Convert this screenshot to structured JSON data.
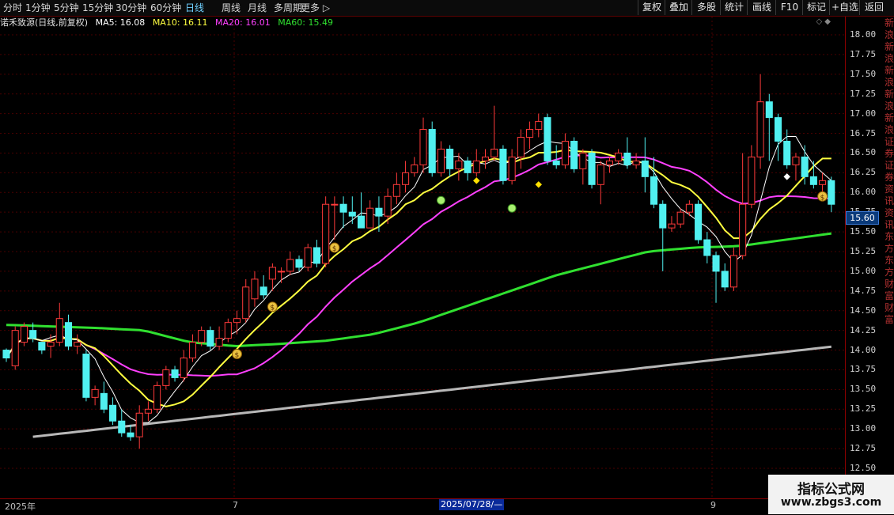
{
  "toolbar": {
    "periods": [
      "分时",
      "1分钟",
      "5分钟",
      "15分钟",
      "30分钟",
      "60分钟",
      "日线",
      "周线",
      "月线",
      "多周期",
      "更多"
    ],
    "active_period": "日线",
    "right_buttons": [
      "复权",
      "叠加",
      "多股",
      "统计",
      "画线",
      "F10",
      "标记",
      "+自选",
      "返回"
    ]
  },
  "title": {
    "name": "诺禾致源(日线,前复权)",
    "ma5": "MA5: 16.08",
    "ma10": "MA10: 16.11",
    "ma20": "MA20: 16.01",
    "ma60": "MA60: 15.49"
  },
  "colors": {
    "ma5": "#ffffff",
    "ma10": "#ffff40",
    "ma20": "#ff40ff",
    "ma60": "#30e030",
    "ma250": "#b8b8b8",
    "up": "#ff3a3a",
    "down": "#50f0f0"
  },
  "current_price": "15.60",
  "x_labels": [
    "2025年",
    "7",
    "9"
  ],
  "x_selected": "2025/07/28/—",
  "right_news": "新浪新浪新浪新浪新浪证券证券资讯资讯东方东方财富财富",
  "chart_data": {
    "type": "candlestick",
    "ylim": [
      12.5,
      18.15
    ],
    "yticks": [
      12.5,
      12.75,
      13.0,
      13.25,
      13.5,
      13.75,
      14.0,
      14.25,
      14.5,
      14.75,
      15.0,
      15.25,
      15.5,
      15.75,
      16.0,
      16.25,
      16.5,
      16.75,
      17.0,
      17.25,
      17.5,
      17.75,
      18.0
    ],
    "candles": [
      [
        14.0,
        13.9,
        13.85,
        14.02
      ],
      [
        13.8,
        14.25,
        13.75,
        14.3
      ],
      [
        14.1,
        14.3,
        14.05,
        14.35
      ],
      [
        14.25,
        14.15,
        14.1,
        14.35
      ],
      [
        14.1,
        14.0,
        13.95,
        14.1
      ],
      [
        14.05,
        14.1,
        13.9,
        14.2
      ],
      [
        14.1,
        14.4,
        14.05,
        14.6
      ],
      [
        14.35,
        14.05,
        14.0,
        14.45
      ],
      [
        14.05,
        14.1,
        13.95,
        14.2
      ],
      [
        13.95,
        13.4,
        13.35,
        14.0
      ],
      [
        13.4,
        13.5,
        13.3,
        13.55
      ],
      [
        13.45,
        13.25,
        13.2,
        13.6
      ],
      [
        13.3,
        13.1,
        13.05,
        13.4
      ],
      [
        13.1,
        12.95,
        12.9,
        13.25
      ],
      [
        12.95,
        12.9,
        12.85,
        13.05
      ],
      [
        12.9,
        13.2,
        12.75,
        13.3
      ],
      [
        13.2,
        13.25,
        13.1,
        13.35
      ],
      [
        13.25,
        13.55,
        13.2,
        13.6
      ],
      [
        13.55,
        13.75,
        13.5,
        13.8
      ],
      [
        13.75,
        13.65,
        13.6,
        13.8
      ],
      [
        13.65,
        13.9,
        13.6,
        14.0
      ],
      [
        13.9,
        14.1,
        13.85,
        14.2
      ],
      [
        14.1,
        14.25,
        14.05,
        14.3
      ],
      [
        14.25,
        14.05,
        14.0,
        14.3
      ],
      [
        14.05,
        14.15,
        14.0,
        14.3
      ],
      [
        14.15,
        14.35,
        14.1,
        14.4
      ],
      [
        14.35,
        14.4,
        14.2,
        14.5
      ],
      [
        14.4,
        14.8,
        14.35,
        14.9
      ],
      [
        14.65,
        14.9,
        14.55,
        15.0
      ],
      [
        14.8,
        14.7,
        14.65,
        14.95
      ],
      [
        14.9,
        15.05,
        14.75,
        15.1
      ],
      [
        15.0,
        15.0,
        14.85,
        15.05
      ],
      [
        15.0,
        15.15,
        14.95,
        15.25
      ],
      [
        15.15,
        15.05,
        15.0,
        15.2
      ],
      [
        15.05,
        15.3,
        15.0,
        15.35
      ],
      [
        15.3,
        15.1,
        15.05,
        15.4
      ],
      [
        15.1,
        15.85,
        15.05,
        15.95
      ],
      [
        15.85,
        15.85,
        15.4,
        15.95
      ],
      [
        15.85,
        15.75,
        15.55,
        15.95
      ],
      [
        15.75,
        15.7,
        15.6,
        15.95
      ],
      [
        15.7,
        15.55,
        15.55,
        16.0
      ],
      [
        15.55,
        15.8,
        15.55,
        15.9
      ],
      [
        15.8,
        15.7,
        15.5,
        15.95
      ],
      [
        15.7,
        15.95,
        15.6,
        16.05
      ],
      [
        15.95,
        16.1,
        15.85,
        16.25
      ],
      [
        16.1,
        16.25,
        16.0,
        16.4
      ],
      [
        16.25,
        16.35,
        16.2,
        16.45
      ],
      [
        16.35,
        16.8,
        16.25,
        16.95
      ],
      [
        16.8,
        16.25,
        16.2,
        16.9
      ],
      [
        16.25,
        16.55,
        16.2,
        16.65
      ],
      [
        16.55,
        16.3,
        16.2,
        16.6
      ],
      [
        16.3,
        16.4,
        16.15,
        16.5
      ],
      [
        16.4,
        16.25,
        16.15,
        16.45
      ],
      [
        16.25,
        16.4,
        16.2,
        16.55
      ],
      [
        16.4,
        16.45,
        16.3,
        16.55
      ],
      [
        16.45,
        16.55,
        16.4,
        17.1
      ],
      [
        16.55,
        16.15,
        16.1,
        16.6
      ],
      [
        16.15,
        16.45,
        16.1,
        16.55
      ],
      [
        16.45,
        16.7,
        16.3,
        16.8
      ],
      [
        16.7,
        16.8,
        16.55,
        16.9
      ],
      [
        16.8,
        16.9,
        16.7,
        17.0
      ],
      [
        16.95,
        16.4,
        16.35,
        17.0
      ],
      [
        16.4,
        16.35,
        16.3,
        16.6
      ],
      [
        16.35,
        16.65,
        16.3,
        16.75
      ],
      [
        16.65,
        16.3,
        16.25,
        16.7
      ],
      [
        16.3,
        16.5,
        16.1,
        16.55
      ],
      [
        16.5,
        16.1,
        16.05,
        16.55
      ],
      [
        16.1,
        16.35,
        15.85,
        16.4
      ],
      [
        16.35,
        16.4,
        16.25,
        16.45
      ],
      [
        16.4,
        16.5,
        16.35,
        16.55
      ],
      [
        16.5,
        16.35,
        16.3,
        16.7
      ],
      [
        16.35,
        16.4,
        16.3,
        16.5
      ],
      [
        16.4,
        16.2,
        16.0,
        16.7
      ],
      [
        16.2,
        15.85,
        15.8,
        16.45
      ],
      [
        15.85,
        15.55,
        15.0,
        15.9
      ],
      [
        15.55,
        15.6,
        15.5,
        15.7
      ],
      [
        15.6,
        15.75,
        15.55,
        15.8
      ],
      [
        15.75,
        15.85,
        15.7,
        15.9
      ],
      [
        15.85,
        15.4,
        15.35,
        15.9
      ],
      [
        15.4,
        15.2,
        15.1,
        15.5
      ],
      [
        15.2,
        15.0,
        14.6,
        15.25
      ],
      [
        15.0,
        14.8,
        14.75,
        15.1
      ],
      [
        14.8,
        15.2,
        14.75,
        15.3
      ],
      [
        15.2,
        15.85,
        15.15,
        16.5
      ],
      [
        15.85,
        16.45,
        15.8,
        16.6
      ],
      [
        16.45,
        17.15,
        16.3,
        17.5
      ],
      [
        17.15,
        16.95,
        16.4,
        17.25
      ],
      [
        16.95,
        16.65,
        16.4,
        17.0
      ],
      [
        16.65,
        16.35,
        16.3,
        16.8
      ],
      [
        16.35,
        16.45,
        16.15,
        16.5
      ],
      [
        16.45,
        16.2,
        16.1,
        16.6
      ],
      [
        16.2,
        16.1,
        16.05,
        16.4
      ],
      [
        16.1,
        16.15,
        15.9,
        16.25
      ],
      [
        16.15,
        15.85,
        15.75,
        16.2
      ]
    ],
    "ma_current": {
      "MA5": 16.08,
      "MA10": 16.11,
      "MA20": 16.01,
      "MA60": 15.49
    }
  }
}
